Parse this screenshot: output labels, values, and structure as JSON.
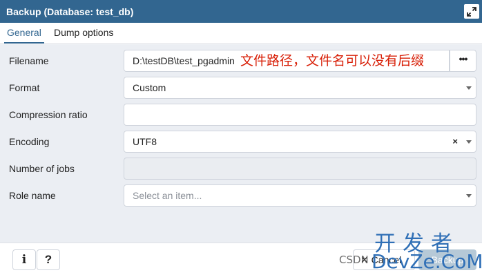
{
  "dialog": {
    "title": "Backup (Database: test_db)"
  },
  "tabs": [
    {
      "label": "General",
      "active": true
    },
    {
      "label": "Dump options",
      "active": false
    }
  ],
  "form": {
    "filename": {
      "label": "Filename",
      "value": "D:\\testDB\\test_pgadmin",
      "annotation": "文件路径，文件名可以没有后缀",
      "browse_label": "•••"
    },
    "format": {
      "label": "Format",
      "value": "Custom"
    },
    "compression_ratio": {
      "label": "Compression ratio",
      "value": ""
    },
    "encoding": {
      "label": "Encoding",
      "value": "UTF8",
      "clear": "×"
    },
    "number_of_jobs": {
      "label": "Number of jobs",
      "value": ""
    },
    "role_name": {
      "label": "Role name",
      "placeholder": "Select an item..."
    }
  },
  "footer": {
    "info_label": "i",
    "help_label": "?",
    "cancel_label": "✕ Cancel",
    "backup_label": "Backup"
  },
  "watermark": {
    "csdn": "CSDN",
    "cn": "开发者",
    "en": "DevZe.CoM"
  },
  "colors": {
    "accent": "#326690",
    "annotation": "#d81e06",
    "panel_bg": "#ebeef3"
  }
}
